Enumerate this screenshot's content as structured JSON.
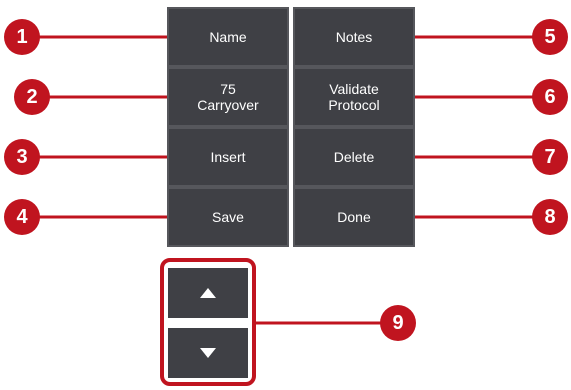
{
  "buttons": {
    "name": "Name",
    "notes": "Notes",
    "carryover": "75\nCarryover",
    "validate_protocol": "Validate\nProtocol",
    "insert": "Insert",
    "delete": "Delete",
    "save": "Save",
    "done": "Done"
  },
  "navigation": {
    "up_icon": "arrow-up",
    "down_icon": "arrow-down"
  },
  "callouts": [
    "1",
    "2",
    "3",
    "4",
    "5",
    "6",
    "7",
    "8",
    "9"
  ],
  "colors": {
    "callout": "#c0141f",
    "button_bg": "#3f4045",
    "button_text": "#ffffff"
  }
}
